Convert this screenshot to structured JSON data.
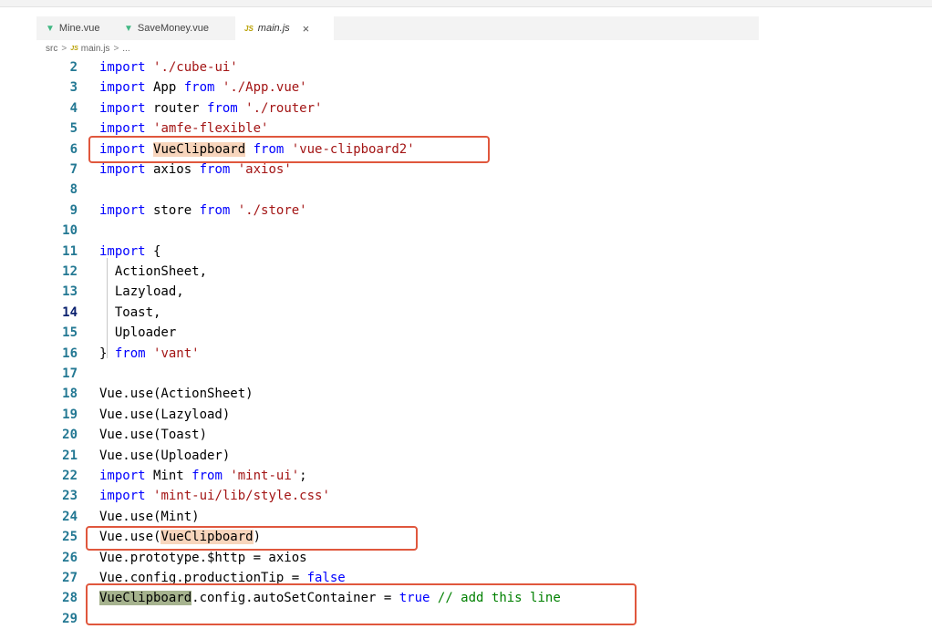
{
  "tabs": [
    {
      "label": "Mine.vue",
      "icon": "vue-icon",
      "active": false
    },
    {
      "label": "SaveMoney.vue",
      "icon": "vue-icon",
      "active": false
    },
    {
      "label": "main.js",
      "icon": "js-icon",
      "active": true
    }
  ],
  "tab_icons": {
    "vue": "▼",
    "js": "JS",
    "close": "×"
  },
  "breadcrumb": {
    "folder": "src",
    "file": "main.js",
    "more": "...",
    "sep": ">"
  },
  "current_line": "14",
  "lines": [
    {
      "n": "2",
      "tokens": [
        {
          "t": "import",
          "c": "kw"
        },
        {
          "t": " "
        },
        {
          "t": "'./cube-ui'",
          "c": "str"
        }
      ]
    },
    {
      "n": "3",
      "tokens": [
        {
          "t": "import",
          "c": "kw"
        },
        {
          "t": " App "
        },
        {
          "t": "from",
          "c": "kw"
        },
        {
          "t": " "
        },
        {
          "t": "'./App.vue'",
          "c": "str"
        }
      ]
    },
    {
      "n": "4",
      "tokens": [
        {
          "t": "import",
          "c": "kw"
        },
        {
          "t": " router "
        },
        {
          "t": "from",
          "c": "kw"
        },
        {
          "t": " "
        },
        {
          "t": "'./router'",
          "c": "str"
        }
      ]
    },
    {
      "n": "5",
      "tokens": [
        {
          "t": "import",
          "c": "kw"
        },
        {
          "t": " "
        },
        {
          "t": "'amfe-flexible'",
          "c": "str"
        }
      ]
    },
    {
      "n": "6",
      "tokens": [
        {
          "t": "import",
          "c": "kw"
        },
        {
          "t": " "
        },
        {
          "t": "VueClipboard",
          "c": "hl-orange"
        },
        {
          "t": " "
        },
        {
          "t": "from",
          "c": "kw"
        },
        {
          "t": " "
        },
        {
          "t": "'vue-clipboard2'",
          "c": "str"
        }
      ]
    },
    {
      "n": "7",
      "tokens": [
        {
          "t": "import",
          "c": "kw"
        },
        {
          "t": " axios "
        },
        {
          "t": "from",
          "c": "kw"
        },
        {
          "t": " "
        },
        {
          "t": "'axios'",
          "c": "str"
        }
      ]
    },
    {
      "n": "8",
      "tokens": []
    },
    {
      "n": "9",
      "tokens": [
        {
          "t": "import",
          "c": "kw"
        },
        {
          "t": " store "
        },
        {
          "t": "from",
          "c": "kw"
        },
        {
          "t": " "
        },
        {
          "t": "'./store'",
          "c": "str"
        }
      ]
    },
    {
      "n": "10",
      "tokens": []
    },
    {
      "n": "11",
      "tokens": [
        {
          "t": "import",
          "c": "kw"
        },
        {
          "t": " {"
        }
      ]
    },
    {
      "n": "12",
      "tokens": [
        {
          "t": "  ActionSheet,"
        }
      ]
    },
    {
      "n": "13",
      "tokens": [
        {
          "t": "  Lazyload,"
        }
      ]
    },
    {
      "n": "14",
      "tokens": [
        {
          "t": "  Toast,"
        }
      ]
    },
    {
      "n": "15",
      "tokens": [
        {
          "t": "  Uploader"
        }
      ]
    },
    {
      "n": "16",
      "tokens": [
        {
          "t": "} "
        },
        {
          "t": "from",
          "c": "kw"
        },
        {
          "t": " "
        },
        {
          "t": "'vant'",
          "c": "str"
        }
      ]
    },
    {
      "n": "17",
      "tokens": []
    },
    {
      "n": "18",
      "tokens": [
        {
          "t": "Vue.use(ActionSheet)"
        }
      ]
    },
    {
      "n": "19",
      "tokens": [
        {
          "t": "Vue.use(Lazyload)"
        }
      ]
    },
    {
      "n": "20",
      "tokens": [
        {
          "t": "Vue.use(Toast)"
        }
      ]
    },
    {
      "n": "21",
      "tokens": [
        {
          "t": "Vue.use(Uploader)"
        }
      ]
    },
    {
      "n": "22",
      "tokens": [
        {
          "t": "import",
          "c": "kw"
        },
        {
          "t": " Mint "
        },
        {
          "t": "from",
          "c": "kw"
        },
        {
          "t": " "
        },
        {
          "t": "'mint-ui'",
          "c": "str"
        },
        {
          "t": ";"
        }
      ]
    },
    {
      "n": "23",
      "tokens": [
        {
          "t": "import",
          "c": "kw"
        },
        {
          "t": " "
        },
        {
          "t": "'mint-ui/lib/style.css'",
          "c": "str"
        }
      ]
    },
    {
      "n": "24",
      "tokens": [
        {
          "t": "Vue.use(Mint)"
        }
      ]
    },
    {
      "n": "25",
      "tokens": [
        {
          "t": "Vue.use("
        },
        {
          "t": "VueClipboard",
          "c": "hl-orange"
        },
        {
          "t": ")"
        }
      ]
    },
    {
      "n": "26",
      "tokens": [
        {
          "t": "Vue.prototype.$http = axios"
        }
      ]
    },
    {
      "n": "27",
      "tokens": [
        {
          "t": "Vue.config.productionTip = "
        },
        {
          "t": "false",
          "c": "bool"
        }
      ]
    },
    {
      "n": "28",
      "tokens": [
        {
          "t": "VueClipboard",
          "c": "hl-green"
        },
        {
          "t": ".config.autoSetContainer = "
        },
        {
          "t": "true",
          "c": "bool"
        },
        {
          "t": " "
        },
        {
          "t": "// add this line",
          "c": "cm"
        }
      ]
    },
    {
      "n": "29",
      "tokens": []
    }
  ]
}
